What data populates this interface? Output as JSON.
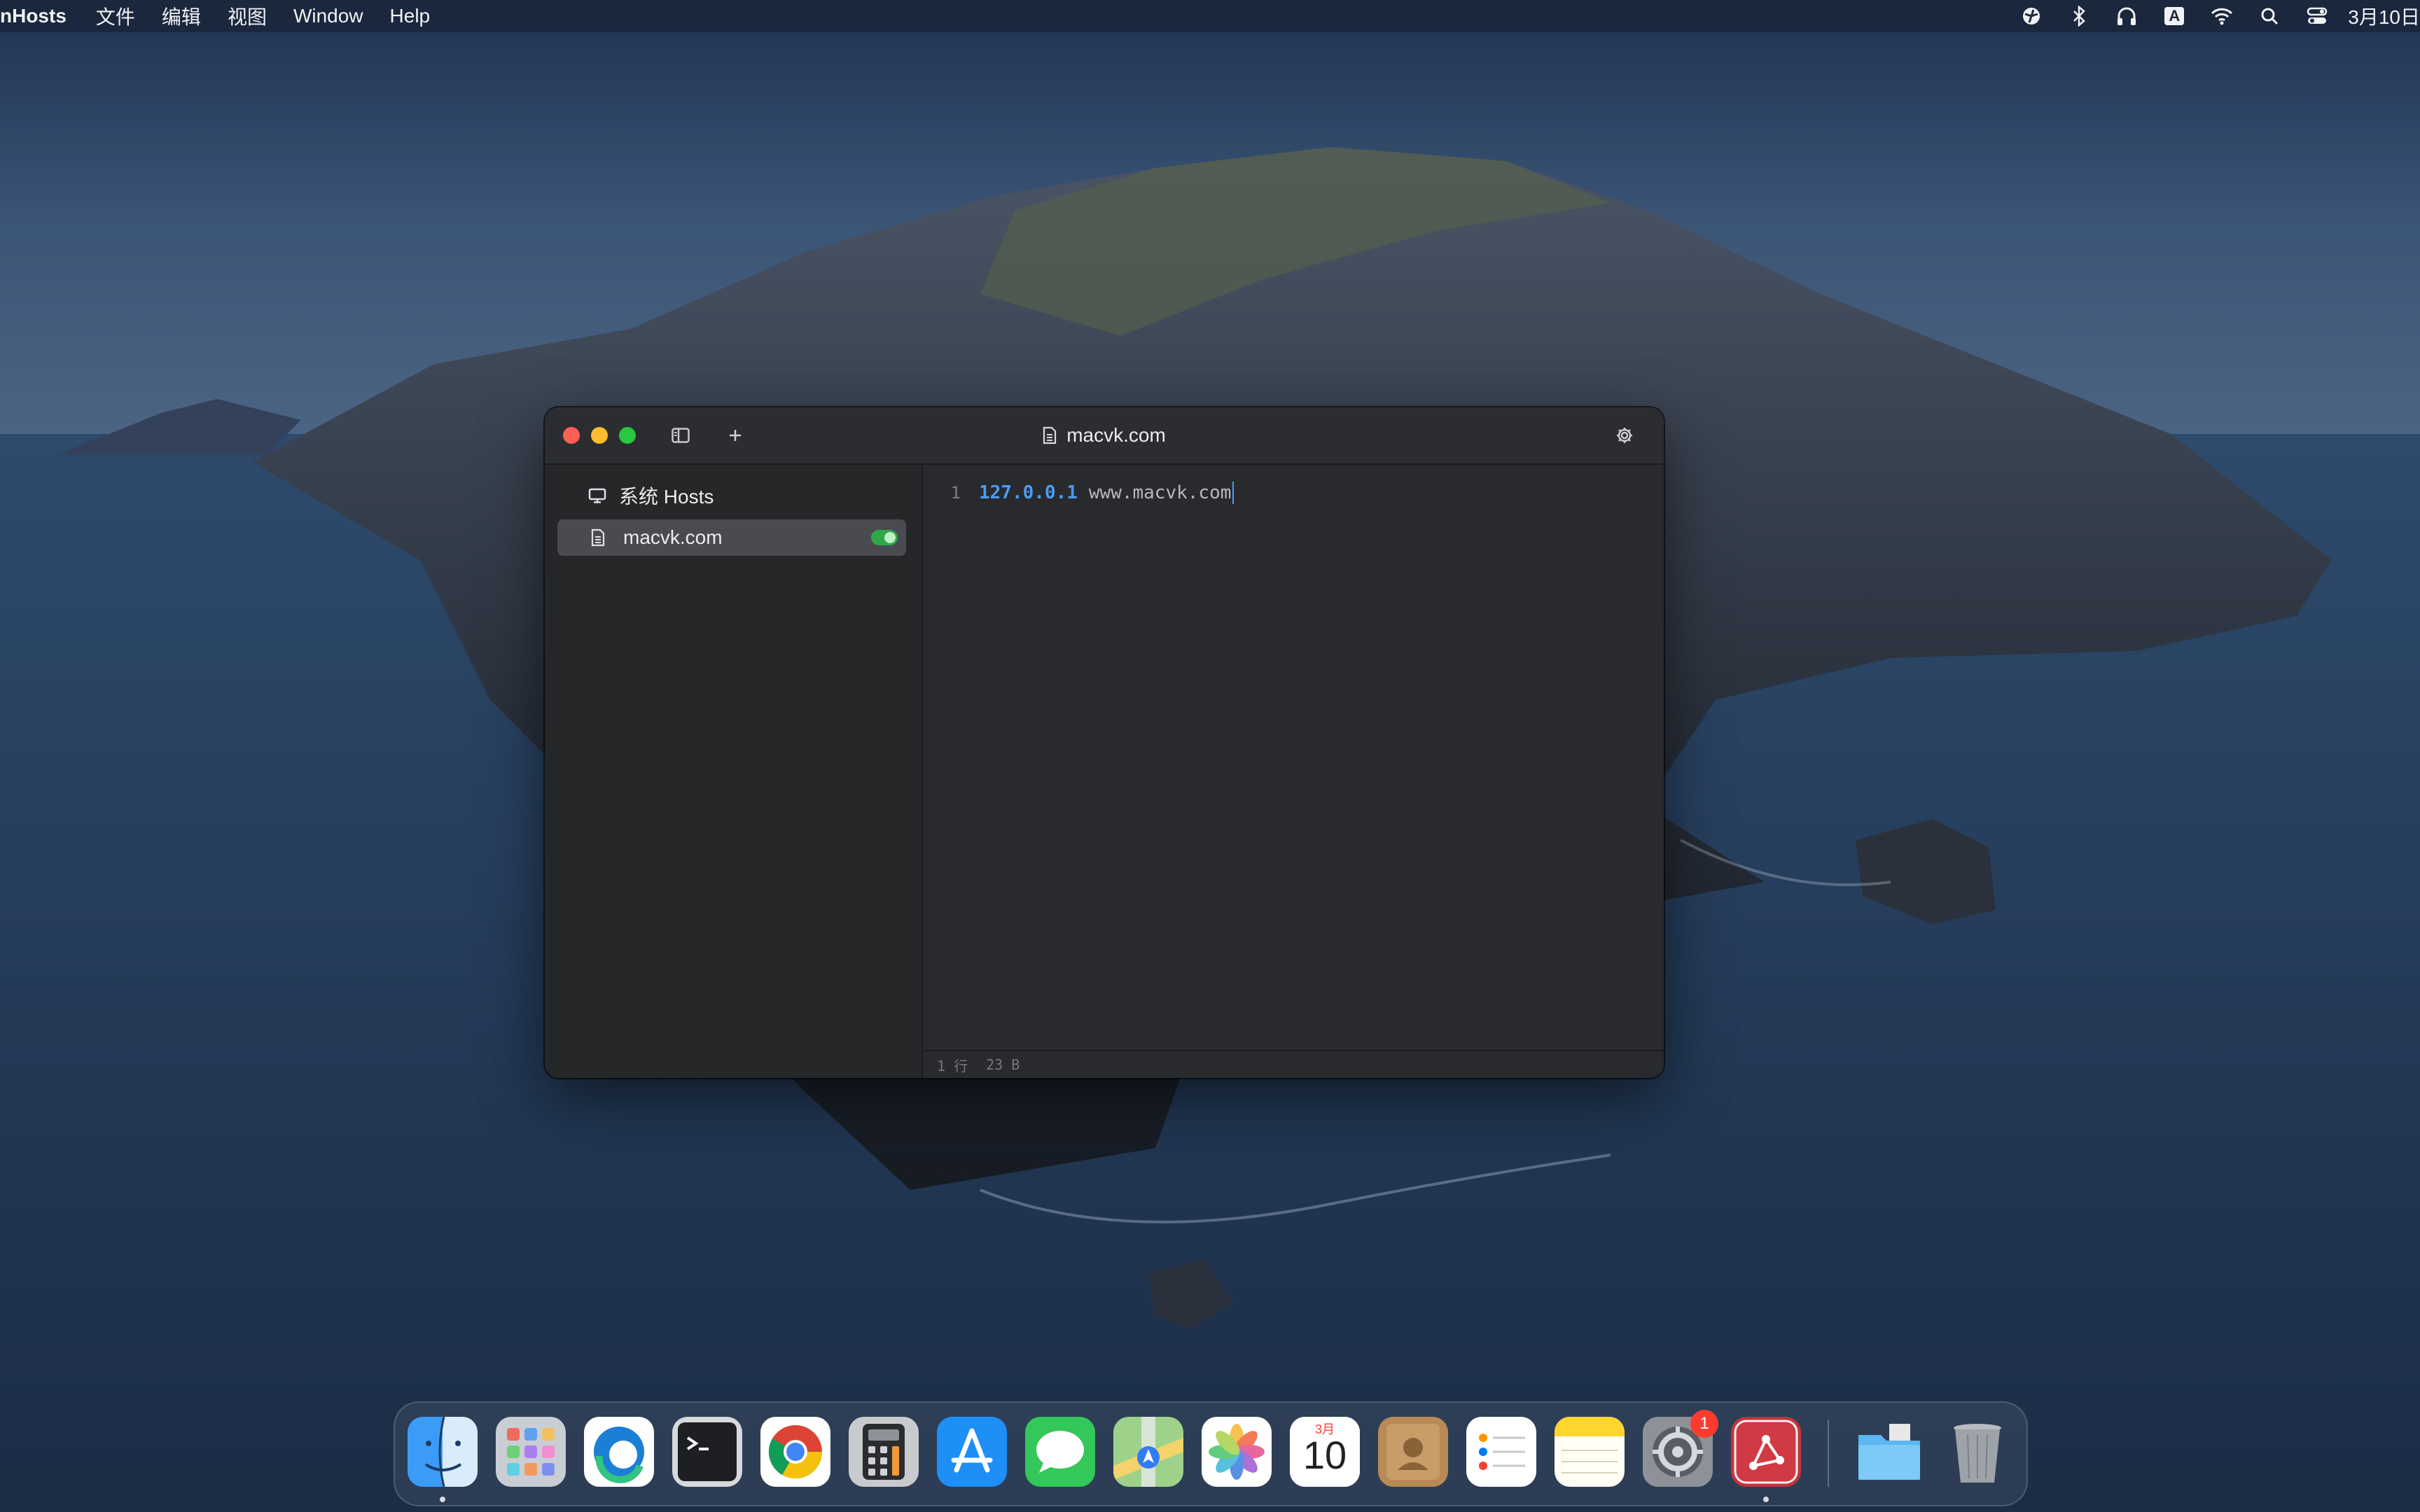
{
  "menubar": {
    "app_name": "nHosts",
    "menus": [
      "文件",
      "编辑",
      "视图",
      "Window",
      "Help"
    ],
    "status_icons": [
      "vpn-icon",
      "bluetooth-icon",
      "headphones-icon",
      "input-source-icon",
      "wifi-icon",
      "spotlight-icon",
      "control-center-icon"
    ],
    "input_source": "A",
    "clock": "3月10日"
  },
  "window": {
    "title": "macvk.com",
    "sidebar": {
      "system_hosts": "系统 Hosts",
      "items": [
        {
          "label": "macvk.com",
          "enabled": true,
          "selected": true
        }
      ]
    },
    "editor": {
      "lines": [
        {
          "number": "1",
          "ip": "127.0.0.1",
          "host": "www.macvk.com"
        }
      ],
      "status_lines": "1 行",
      "status_size": "23 B"
    }
  },
  "dock": {
    "apps": [
      "Finder",
      "Launchpad",
      "Microsoft Edge",
      "Terminal",
      "Google Chrome",
      "Calculator",
      "App Store",
      "Messages",
      "Maps",
      "Photos",
      "Calendar",
      "Contacts",
      "Reminders",
      "Notes",
      "System Preferences",
      "SwitchHosts",
      "Downloads",
      "Trash"
    ],
    "calendar_month": "3月",
    "calendar_day": "10",
    "settings_badge": "1"
  }
}
